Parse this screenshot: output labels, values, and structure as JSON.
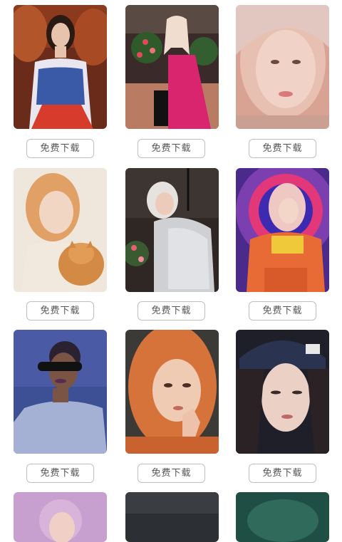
{
  "gallery": {
    "download_label": "免费下载",
    "items": [
      {
        "row": 1,
        "col": 1,
        "accent": "#c65a2a"
      },
      {
        "row": 1,
        "col": 2,
        "accent": "#d8256e"
      },
      {
        "row": 1,
        "col": 3,
        "accent": "#e9b3a7"
      },
      {
        "row": 2,
        "col": 1,
        "accent": "#e2a46b"
      },
      {
        "row": 2,
        "col": 2,
        "accent": "#cfd0d3"
      },
      {
        "row": 2,
        "col": 3,
        "accent": "#e86a35"
      },
      {
        "row": 3,
        "col": 1,
        "accent": "#5b6cb2"
      },
      {
        "row": 3,
        "col": 2,
        "accent": "#d6733a"
      },
      {
        "row": 3,
        "col": 3,
        "accent": "#2a3350"
      },
      {
        "row": 4,
        "col": 1,
        "accent": "#c8a0cf"
      },
      {
        "row": 4,
        "col": 2,
        "accent": "#2c3034"
      },
      {
        "row": 4,
        "col": 3,
        "accent": "#1f4e45"
      }
    ]
  }
}
